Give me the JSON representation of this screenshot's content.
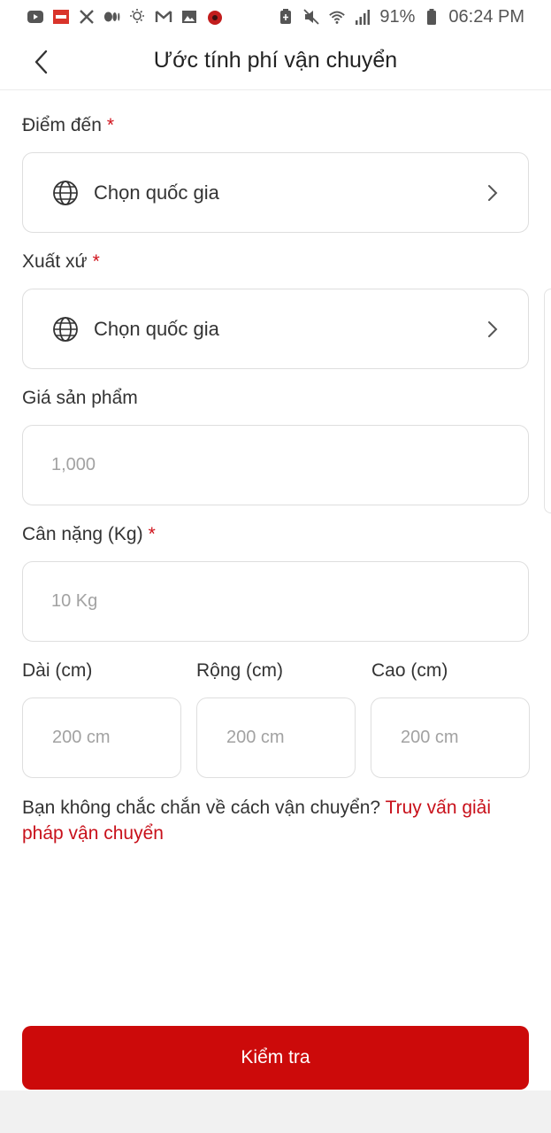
{
  "status_bar": {
    "left_icons": [
      "youtube-icon",
      "news-app-icon",
      "x-icon",
      "medium-icon",
      "weather-icon",
      "gmail-icon",
      "gallery-icon",
      "game-icon"
    ],
    "right_icons": [
      "battery-saver-icon",
      "mute-icon",
      "wifi-icon",
      "signal-icon",
      "battery-icon"
    ],
    "battery": "91%",
    "time": "06:24 PM"
  },
  "header": {
    "title": "Ước tính phí vận chuyển"
  },
  "form": {
    "destination": {
      "label": "Điểm đến",
      "required": "*",
      "value": "Chọn quốc gia"
    },
    "origin": {
      "label": "Xuất xứ",
      "required": "*",
      "value": "Chọn quốc gia"
    },
    "price": {
      "label": "Giá sản phẩm",
      "placeholder": "1,000"
    },
    "weight": {
      "label": "Cân nặng (Kg)",
      "required": "*",
      "placeholder": "10 Kg"
    },
    "length": {
      "label": "Dài (cm)",
      "placeholder": "200 cm"
    },
    "width": {
      "label": "Rộng (cm)",
      "placeholder": "200 cm"
    },
    "height": {
      "label": "Cao (cm)",
      "placeholder": "200 cm"
    }
  },
  "help": {
    "text": "Bạn không chắc chắn về cách vận chuyển? ",
    "link": "Truy vấn giải pháp vận chuyển"
  },
  "submit_label": "Kiểm tra",
  "colors": {
    "accent": "#cc0a0a",
    "required": "#d0121b",
    "border": "#dedede",
    "placeholder": "#a2a2a2"
  }
}
